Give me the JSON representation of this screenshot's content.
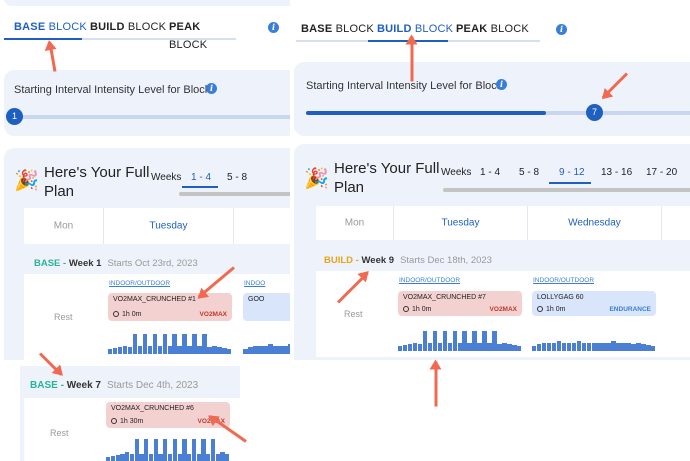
{
  "colors": {
    "accent": "#1f5fbf",
    "base": "#2bb39a",
    "build": "#e8a417",
    "red_tag": "#c0392b",
    "blue_tag": "#3a7fd5",
    "arrow": "#ef6a50"
  },
  "left": {
    "tabs": [
      {
        "bold": "BASE",
        "rest": "BLOCK"
      },
      {
        "bold": "BUILD",
        "rest": "BLOCK"
      },
      {
        "bold": "PEAK",
        "rest": "BLOCK"
      }
    ],
    "active_tab": 0,
    "intensity_label": "Starting Interval Intensity Level for Block",
    "slider_value": "1",
    "plan_title_1": "Here's Your Full",
    "plan_title_2": "Plan",
    "weeks_label": "Weeks",
    "week_ranges": [
      "1 - 4",
      "5 - 8"
    ],
    "days": [
      "Mon",
      "Tuesday"
    ],
    "week_row": {
      "block": "BASE",
      "dash": " - ",
      "week": "Week 1",
      "starts": "Starts Oct 23rd, 2023",
      "rest": "Rest",
      "indoor": "INDOOR/OUTDOOR",
      "workout_name": "VO2MAX_CRUNCHED #1",
      "duration": "1h 0m",
      "tag": "VO2MAX",
      "indoor2": "INDOO",
      "workout2_name": "GOO"
    }
  },
  "right": {
    "tabs": [
      {
        "bold": "BASE",
        "rest": "BLOCK"
      },
      {
        "bold": "BUILD",
        "rest": "BLOCK"
      },
      {
        "bold": "PEAK",
        "rest": "BLOCK"
      }
    ],
    "active_tab": 1,
    "intensity_label": "Starting Interval Intensity Level for Block",
    "slider_value": "7",
    "slider_fraction": 0.6,
    "plan_title_1": "Here's Your Full",
    "plan_title_2": "Plan",
    "weeks_label": "Weeks",
    "week_ranges": [
      "1 - 4",
      "5 - 8",
      "9 - 12",
      "13 - 16",
      "17 - 20"
    ],
    "active_range": 2,
    "days": [
      "Mon",
      "Tuesday",
      "Wednesday"
    ],
    "week_row": {
      "block": "BUILD",
      "dash": " - ",
      "week": "Week 9",
      "starts": "Starts Dec 18th, 2023",
      "rest": "Rest"
    },
    "workouts": [
      {
        "indoor": "INDOOR/OUTDOOR",
        "name": "VO2MAX_CRUNCHED #7",
        "duration": "1h 0m",
        "tag": "VO2MAX",
        "color": "red"
      },
      {
        "indoor": "INDOOR/OUTDOOR",
        "name": "LOLLYGAG 60",
        "duration": "1h 0m",
        "tag": "ENDURANCE",
        "color": "blue"
      }
    ]
  },
  "bottom": {
    "week_row": {
      "block": "BASE",
      "dash": " - ",
      "week": "Week 7",
      "starts": "Starts Dec 4th, 2023",
      "rest": "Rest",
      "workout_name": "VO2MAX_CRUNCHED #6",
      "duration": "1h 30m",
      "tag": "VO2MAX"
    }
  }
}
